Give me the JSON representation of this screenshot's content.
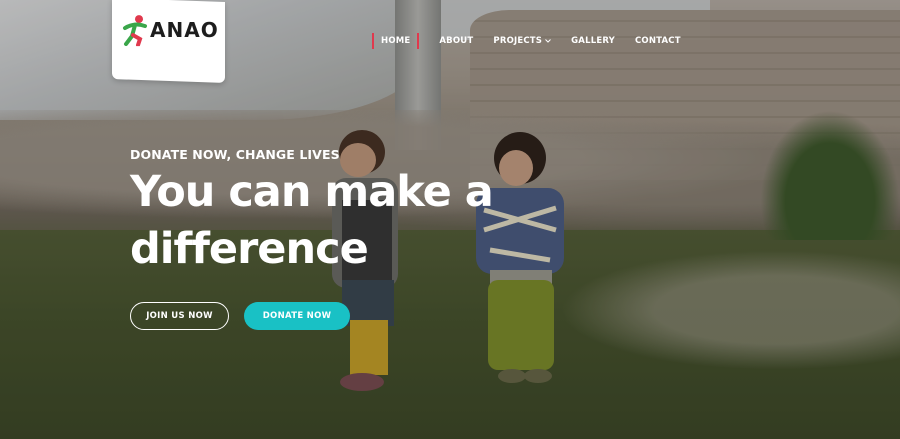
{
  "logo": {
    "text": "ANAO",
    "icon": "running-figure-icon"
  },
  "nav": {
    "items": [
      {
        "label": "HOME",
        "active": true
      },
      {
        "label": "ABOUT"
      },
      {
        "label": "PROJECTS",
        "has_dropdown": true
      },
      {
        "label": "GALLERY"
      },
      {
        "label": "CONTACT"
      }
    ],
    "dropdown_icon": "chevron-down-icon"
  },
  "hero": {
    "kicker": "DONATE NOW, CHANGE LIVES",
    "headline_line1": "You can make a",
    "headline_line2": "difference",
    "join_label": "JOIN US NOW",
    "donate_label": "DONATE NOW"
  },
  "colors": {
    "accent": "#19c1c5",
    "active_marker": "#e0394d",
    "logo_green": "#3aa64a",
    "logo_red": "#e0394d"
  }
}
